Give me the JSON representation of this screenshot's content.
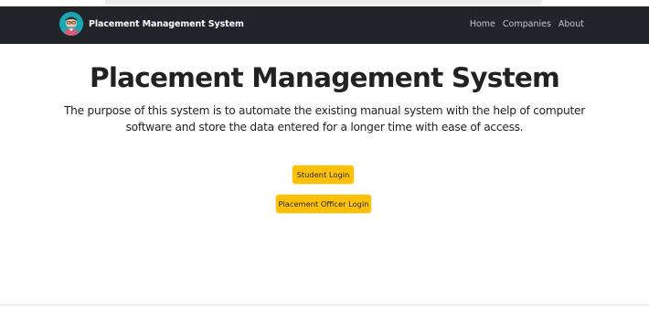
{
  "header": {
    "brand": {
      "title": "Placement Management System",
      "logo_icon": "student-avatar-icon"
    },
    "nav": [
      {
        "label": "Home"
      },
      {
        "label": "Companies"
      },
      {
        "label": "About"
      }
    ]
  },
  "main": {
    "title": "Placement Management System",
    "description": "The purpose of this system is to automate the existing manual system with the help of computer software and store the data entered for a longer time with ease of access.",
    "buttons": {
      "student_login": "Student Login",
      "officer_login": "Placement Officer Login"
    }
  },
  "colors": {
    "navbar_bg": "#212529",
    "button_bg": "#ffc107",
    "page_bg": "#ffffff"
  }
}
